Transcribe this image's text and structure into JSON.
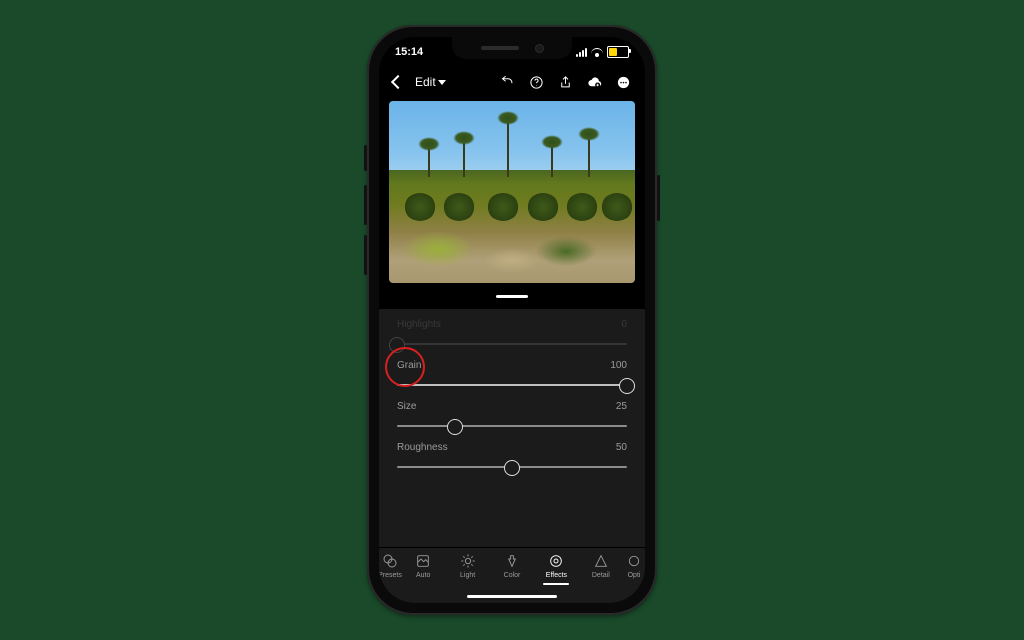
{
  "status": {
    "time": "15:14"
  },
  "toolbar": {
    "edit_label": "Edit"
  },
  "sliders": {
    "highlights": {
      "label": "Highlights",
      "value": "0",
      "pos": 0
    },
    "grain": {
      "label": "Grain",
      "value": "100",
      "pos": 100
    },
    "size": {
      "label": "Size",
      "value": "25",
      "pos": 25
    },
    "roughness": {
      "label": "Roughness",
      "value": "50",
      "pos": 50
    }
  },
  "tools": {
    "presets": "Presets",
    "auto": "Auto",
    "light": "Light",
    "color": "Color",
    "effects": "Effects",
    "detail": "Detail",
    "optics": "Opti"
  }
}
